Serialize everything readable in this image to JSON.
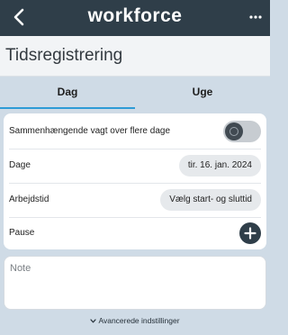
{
  "topbar": {
    "brand": "workforce",
    "back_icon": "chevron-left-icon",
    "more_icon": "more-horizontal-icon",
    "bg_color": "#2f3e49"
  },
  "page": {
    "title": "Tidsregistrering"
  },
  "tabs": [
    {
      "label": "Dag",
      "active": true
    },
    {
      "label": "Uge",
      "active": false
    }
  ],
  "form": {
    "continuous_shift": {
      "label": "Sammenhængende vagt over flere dage",
      "on": false
    },
    "days": {
      "label": "Dage",
      "value": "tir. 16. jan. 2024"
    },
    "worktime": {
      "label": "Arbejdstid",
      "value": "Vælg start- og sluttid"
    },
    "pause": {
      "label": "Pause",
      "icon": "plus-icon"
    }
  },
  "note": {
    "placeholder": "Note",
    "value": ""
  },
  "advanced": {
    "label": "Avancerede indstillinger",
    "icon": "chevron-down-icon"
  },
  "colors": {
    "accent": "#2e9bd6",
    "background": "#cfdbe6",
    "dark": "#2f3e49"
  }
}
